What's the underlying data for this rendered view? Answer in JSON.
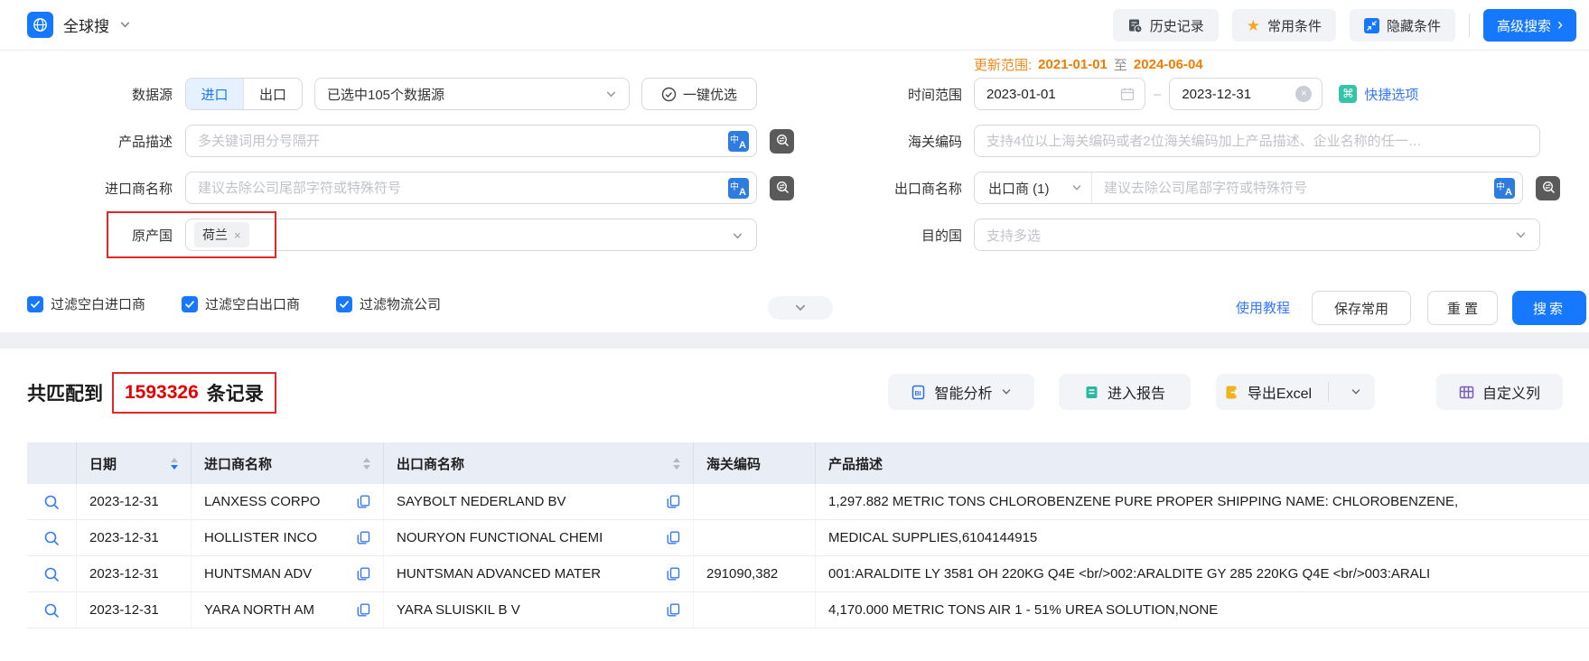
{
  "app": {
    "name": "全球搜"
  },
  "topbar": {
    "history": "历史记录",
    "favorites": "常用条件",
    "hide": "隐藏条件",
    "advanced": "高级搜索"
  },
  "update_range": {
    "label": "更新范围:",
    "start": "2021-01-01",
    "to": "至",
    "end": "2024-06-04"
  },
  "form": {
    "data_source": {
      "label": "数据源",
      "import_tab": "进口",
      "export_tab": "出口",
      "selected_text": "已选中105个数据源",
      "optimize": "一键优选"
    },
    "time_range": {
      "label": "时间范围",
      "start": "2023-01-01",
      "separator": "–",
      "end": "2023-12-31",
      "quick_option": "快捷选项"
    },
    "product_desc": {
      "label": "产品描述",
      "placeholder": "多关键词用分号隔开"
    },
    "hs_code": {
      "label": "海关编码",
      "placeholder": "支持4位以上海关编码或者2位海关编码加上产品描述、企业名称的任一…"
    },
    "importer": {
      "label": "进口商名称",
      "placeholder": "建议去除公司尾部字符或特殊符号"
    },
    "exporter": {
      "label": "出口商名称",
      "type_select": "出口商 (1)",
      "placeholder": "建议去除公司尾部字符或特殊符号"
    },
    "origin": {
      "label": "原产国",
      "tag": "荷兰"
    },
    "destination": {
      "label": "目的国",
      "placeholder": "支持多选"
    },
    "filters": [
      "过滤空白进口商",
      "过滤空白出口商",
      "过滤物流公司"
    ],
    "tutorial": "使用教程",
    "save": "保存常用",
    "reset": "重 置",
    "search": "搜索"
  },
  "results": {
    "matched_prefix": "共匹配到",
    "count": "1593326",
    "matched_suffix": "条记录",
    "analysis_btn": "智能分析",
    "report_btn": "进入报告",
    "export_btn": "导出Excel",
    "custom_columns_btn": "自定义列"
  },
  "table": {
    "headers": {
      "date": "日期",
      "importer": "进口商名称",
      "exporter": "出口商名称",
      "hs_code": "海关编码",
      "product_desc": "产品描述"
    },
    "rows": [
      {
        "date": "2023-12-31",
        "importer": "LANXESS CORPO",
        "exporter": "SAYBOLT NEDERLAND BV",
        "hs_code": "",
        "product_desc": "1,297.882 METRIC TONS CHLOROBENZENE PURE PROPER SHIPPING NAME: CHLOROBENZENE,"
      },
      {
        "date": "2023-12-31",
        "importer": "HOLLISTER INCO",
        "exporter": "NOURYON FUNCTIONAL CHEMI",
        "hs_code": "",
        "product_desc": "MEDICAL SUPPLIES,6104144915"
      },
      {
        "date": "2023-12-31",
        "importer": "HUNTSMAN ADV",
        "exporter": "HUNTSMAN ADVANCED MATER",
        "hs_code": "291090,382",
        "product_desc": "001:ARALDITE LY 3581 OH 220KG Q4E <br/>002:ARALDITE GY 285 220KG Q4E <br/>003:ARALI"
      },
      {
        "date": "2023-12-31",
        "importer": "YARA NORTH AM",
        "exporter": "YARA SLUISKIL B V",
        "hs_code": "",
        "product_desc": "4,170.000 METRIC TONS AIR 1 - 51% UREA SOLUTION,NONE"
      }
    ]
  },
  "icons": {
    "star": "★",
    "command": "⌘",
    "translate_cn": "中",
    "translate_en": "A",
    "close": "×",
    "arrow_right": "›"
  },
  "colors": {
    "accent": "#1677ff",
    "orange": "#f28400",
    "red": "#e60000",
    "teal": "#35c3a9",
    "link": "#3377ff",
    "annotation": "#e12727"
  }
}
